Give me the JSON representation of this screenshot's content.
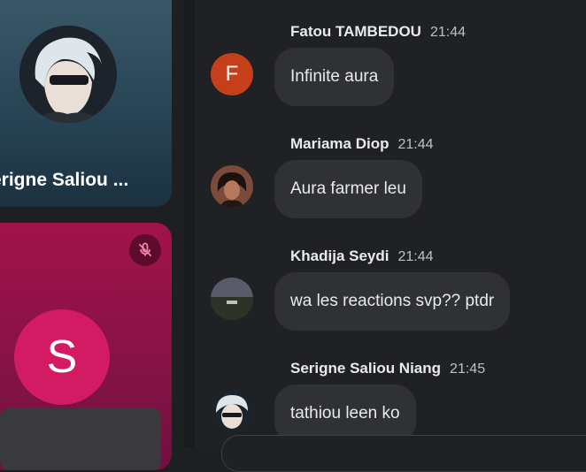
{
  "participants": {
    "tile1": {
      "name": "erigne Saliou ..."
    },
    "tile2": {
      "initial": "S",
      "muted": true
    }
  },
  "messages": [
    {
      "sender": "Fatou TAMBEDOU",
      "time": "21:44",
      "text": "Infinite aura",
      "avatar_letter": "F"
    },
    {
      "sender": "Mariama Diop",
      "time": "21:44",
      "text": "Aura farmer leu"
    },
    {
      "sender": "Khadija Seydi",
      "time": "21:44",
      "text": "wa les reactions svp?? ptdr"
    },
    {
      "sender": "Serigne Saliou Niang",
      "time": "21:45",
      "text": "tathiou leen ko"
    }
  ],
  "colors": {
    "letter_avatar": "#c5401a",
    "initial_circle": "#d21b63",
    "bubble": "#303134"
  },
  "icons": {
    "mute": "mic-off-icon"
  }
}
